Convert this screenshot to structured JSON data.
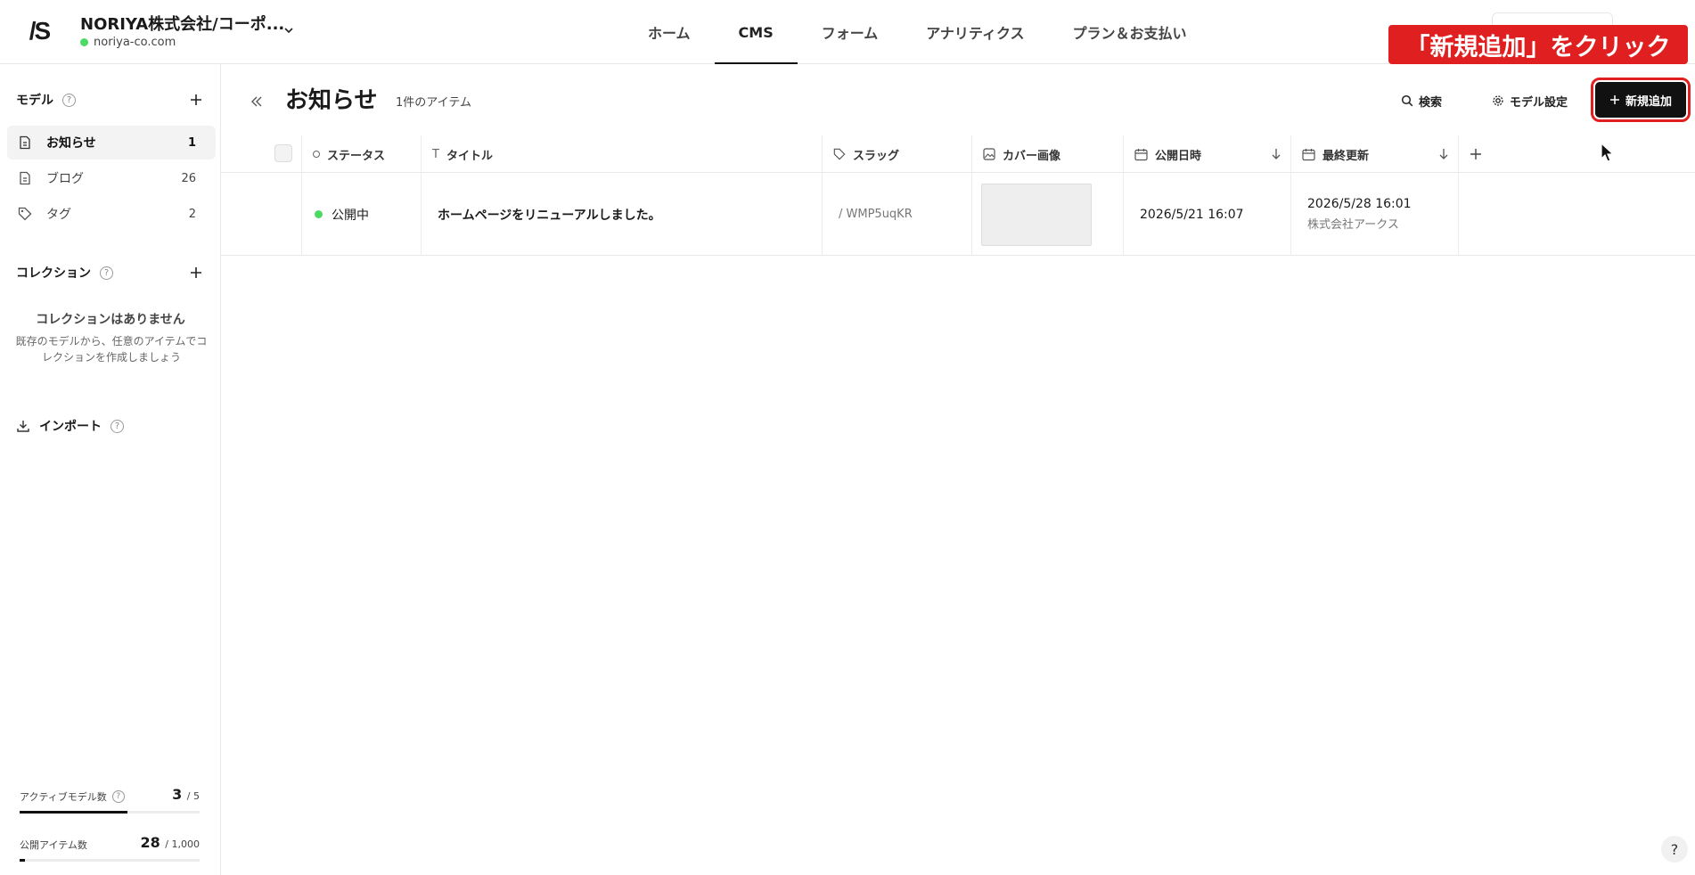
{
  "header": {
    "logo_text": "/S",
    "site_name": "NORIYA株式会社/コーポ...",
    "site_domain": "noriya-co.com",
    "nav_tabs": [
      "ホーム",
      "CMS",
      "フォーム",
      "アナリティクス",
      "プラン＆お支払い"
    ],
    "active_tab": "CMS"
  },
  "annotation": {
    "text": "「新規追加」をクリック",
    "color": "#e02020"
  },
  "sidebar": {
    "models_heading": "モデル",
    "models": [
      {
        "label": "お知らせ",
        "count": "1",
        "icon": "document-icon",
        "active": true
      },
      {
        "label": "ブログ",
        "count": "26",
        "icon": "document-icon",
        "active": false
      },
      {
        "label": "タグ",
        "count": "2",
        "icon": "tag-icon",
        "active": false
      }
    ],
    "collections_heading": "コレクション",
    "collections_empty_title": "コレクションはありません",
    "collections_empty_desc": "既存のモデルから、任意のアイテムでコレクションを作成しましょう",
    "import_label": "インポート",
    "stats": {
      "active_models_label": "アクティブモデル数",
      "active_models_value": "3",
      "active_models_max": "/ 5",
      "published_items_label": "公開アイテム数",
      "published_items_value": "28",
      "published_items_max": "/ 1,000"
    }
  },
  "main": {
    "title": "お知らせ",
    "item_count": "1件のアイテム",
    "search_label": "検索",
    "model_settings_label": "モデル設定",
    "new_button_label": "新規追加",
    "columns": [
      "ステータス",
      "タイトル",
      "スラッグ",
      "カバー画像",
      "公開日時",
      "最終更新"
    ],
    "rows": [
      {
        "status": "公開中",
        "title": "ホームページをリニューアルしました。",
        "slug": "/ WMP5uqKR",
        "published_at": "2026/5/21 16:07",
        "updated_at": "2026/5/28 16:01",
        "updated_by": "株式会社アークス"
      }
    ]
  },
  "help_button": "?"
}
